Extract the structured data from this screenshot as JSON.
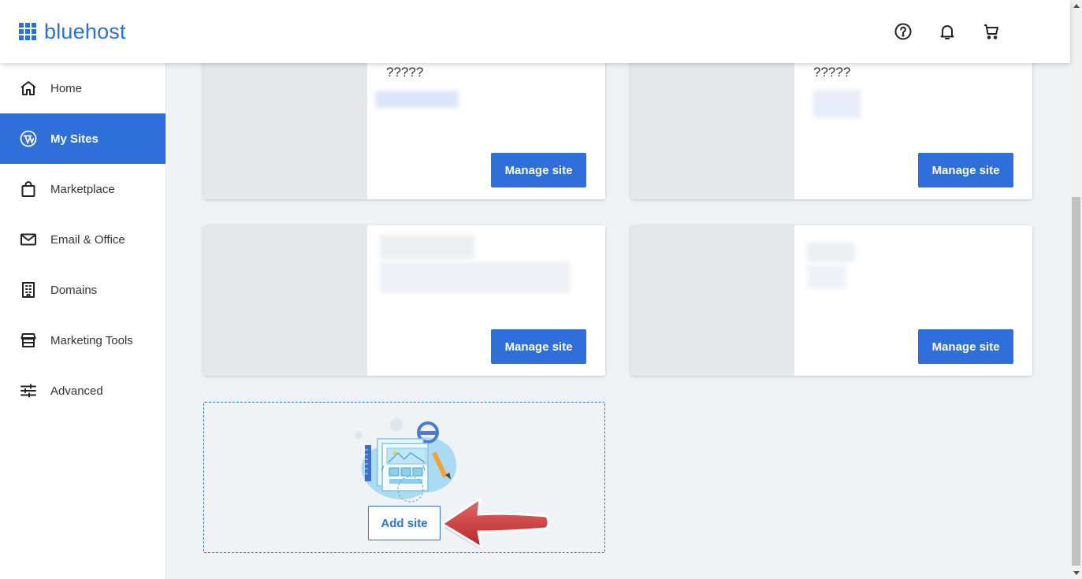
{
  "header": {
    "logo_text": "bluehost",
    "icons": [
      "help-icon",
      "bell-icon",
      "cart-icon"
    ],
    "brand_color": "#2c6fd9"
  },
  "sidebar": {
    "items": [
      {
        "label": "Home",
        "icon": "home-icon",
        "active": false
      },
      {
        "label": "My Sites",
        "icon": "wordpress-icon",
        "active": true
      },
      {
        "label": "Marketplace",
        "icon": "shopping-bag-icon",
        "active": false
      },
      {
        "label": "Email & Office",
        "icon": "mail-icon",
        "active": false
      },
      {
        "label": "Domains",
        "icon": "building-icon",
        "active": false
      },
      {
        "label": "Marketing Tools",
        "icon": "storefront-icon",
        "active": false
      },
      {
        "label": "Advanced",
        "icon": "sliders-icon",
        "active": false
      }
    ],
    "active_color": "#2f6fd9"
  },
  "sites": [
    {
      "name": "?????",
      "manage_label": "Manage site"
    },
    {
      "name": "?????",
      "manage_label": "Manage site"
    },
    {
      "name": "",
      "manage_label": "Manage site"
    },
    {
      "name": "",
      "manage_label": "Manage site"
    }
  ],
  "add_site": {
    "label": "Add site"
  }
}
